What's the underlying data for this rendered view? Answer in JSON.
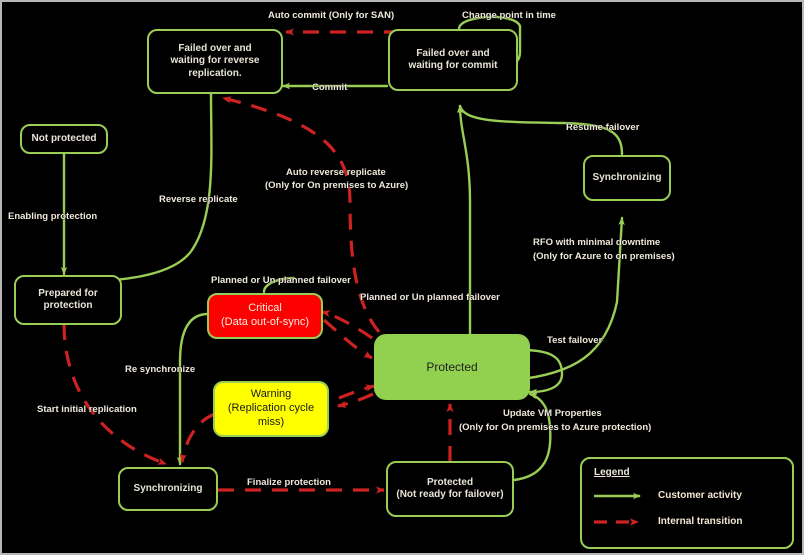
{
  "diagram": {
    "title": "Replication and failover state diagram",
    "colors": {
      "background": "#000000",
      "customer_activity": "#9ACD55",
      "internal_transition": "#CC2222",
      "protected_fill": "#92D050",
      "critical_fill": "#FF0000",
      "warning_fill": "#FFFF00",
      "node_border": "#9ACD55",
      "label_text": "#EFE9DC",
      "frame": "#B7B7B7"
    },
    "nodes": [
      {
        "id": "failed-over-waiting-reverse-replication",
        "lines": [
          "Failed over and",
          "waiting for reverse",
          "replication."
        ],
        "style": "dark"
      },
      {
        "id": "failed-over-waiting-commit",
        "lines": [
          "Failed over and",
          "waiting for commit"
        ],
        "style": "dark"
      },
      {
        "id": "not-protected",
        "lines": [
          "Not protected"
        ],
        "style": "dark"
      },
      {
        "id": "prepared-for-protection",
        "lines": [
          "Prepared for",
          "protection"
        ],
        "style": "dark"
      },
      {
        "id": "synchronizing-right",
        "lines": [
          "Synchronizing"
        ],
        "style": "dark"
      },
      {
        "id": "critical",
        "lines": [
          "Critical",
          "(Data out-of-sync)"
        ],
        "style": "critical"
      },
      {
        "id": "warning",
        "lines": [
          "Warning",
          "(Replication cycle",
          "miss)"
        ],
        "style": "warning"
      },
      {
        "id": "protected",
        "lines": [
          "Protected"
        ],
        "style": "protected"
      },
      {
        "id": "synchronizing-bottom",
        "lines": [
          "Synchronizing"
        ],
        "style": "dark"
      },
      {
        "id": "protected-not-ready",
        "lines": [
          "Protected",
          "(Not ready for failover)"
        ],
        "style": "dark"
      }
    ],
    "edge_labels": [
      {
        "id": "auto-commit",
        "text": "Auto commit   (Only for SAN)",
        "kind": "internal"
      },
      {
        "id": "change-point-in-time",
        "text": "Change point in time",
        "kind": "customer"
      },
      {
        "id": "commit",
        "text": "Commit",
        "kind": "customer"
      },
      {
        "id": "resume-failover",
        "text": "Resume failover",
        "kind": "customer"
      },
      {
        "id": "reverse-replicate",
        "text": "Reverse replicate",
        "kind": "customer"
      },
      {
        "id": "auto-reverse-replicate-l1",
        "text": "Auto reverse replicate",
        "kind": "internal"
      },
      {
        "id": "auto-reverse-replicate-l2",
        "text": "(Only for On premises to Azure)",
        "kind": "internal"
      },
      {
        "id": "enabling-protection",
        "text": "Enabling protection",
        "kind": "customer"
      },
      {
        "id": "rfo-minimal-downtime-l1",
        "text": "RFO with minimal downtime",
        "kind": "customer"
      },
      {
        "id": "rfo-minimal-downtime-l2",
        "text": "(Only for Azure to on premises)",
        "kind": "customer"
      },
      {
        "id": "planned-unplanned-failover-left",
        "text": "Planned or Un planned failover",
        "kind": "customer"
      },
      {
        "id": "planned-unplanned-failover-right",
        "text": "Planned or Un planned failover",
        "kind": "customer"
      },
      {
        "id": "test-failover",
        "text": "Test failover",
        "kind": "customer"
      },
      {
        "id": "re-synchronize",
        "text": "Re synchronize",
        "kind": "customer"
      },
      {
        "id": "start-initial-replication",
        "text": "Start initial replication",
        "kind": "internal"
      },
      {
        "id": "finalize-protection",
        "text": "Finalize protection",
        "kind": "internal"
      },
      {
        "id": "update-vm-properties-l1",
        "text": "Update VM Properties",
        "kind": "customer"
      },
      {
        "id": "update-vm-properties-l2",
        "text": "(Only for On premises to Azure protection)",
        "kind": "customer"
      }
    ],
    "legend": {
      "title": "Legend",
      "items": [
        {
          "id": "customer-activity",
          "label": "Customer activity",
          "style": "solid-green"
        },
        {
          "id": "internal-transition",
          "label": "Internal transition",
          "style": "dashed-red"
        }
      ]
    }
  }
}
